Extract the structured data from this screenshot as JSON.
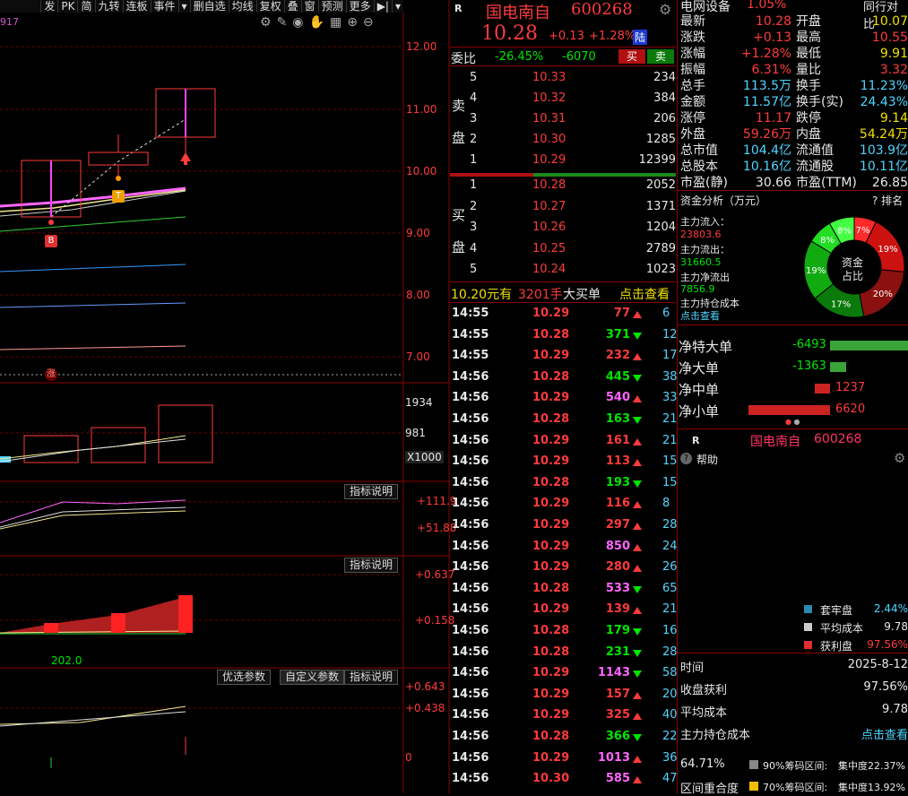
{
  "toolbar": {
    "items": [
      "发",
      "PK",
      "简",
      "九转",
      "连板",
      "事件",
      "▾",
      "删自选",
      "均线",
      "复权",
      "叠",
      "窗",
      "预测",
      "更多",
      "▶|",
      "▾"
    ]
  },
  "chart": {
    "left_code": "917",
    "price_axis": [
      "12.00",
      "11.00",
      "10.00",
      "9.00",
      "8.00",
      "7.00"
    ],
    "limit_mark": "涨",
    "marker_b": "B",
    "marker_t": "T",
    "vol_axis": [
      "1934",
      "981",
      "X1000"
    ],
    "ind1": {
      "btn": "指标说明",
      "axis": [
        "+111.9",
        "+51.88"
      ]
    },
    "ind2": {
      "btn": "指标说明",
      "axis": [
        "+0.637",
        "+0.158"
      ],
      "value": "202.0"
    },
    "ind3": {
      "btn1": "优选参数",
      "btn2": "自定义参数",
      "btn3": "指标说明",
      "axis": [
        "+0.643",
        "+0.438",
        "0"
      ]
    }
  },
  "quote": {
    "r": "R",
    "name": "国电南自",
    "code": "600268",
    "price": "10.28",
    "chg": "+0.13",
    "pct": "+1.28%",
    "lu": "陆",
    "weibi_label": "委比",
    "weibi_pct": "-26.45%",
    "weibi_val": "-6070",
    "buy": "买",
    "sell": "卖",
    "sell_label": "卖盘",
    "buy_label": "买盘",
    "asks": [
      {
        "lvl": "5",
        "p": "10.33",
        "v": "234"
      },
      {
        "lvl": "4",
        "p": "10.32",
        "v": "384"
      },
      {
        "lvl": "3",
        "p": "10.31",
        "v": "206"
      },
      {
        "lvl": "2",
        "p": "10.30",
        "v": "1285"
      },
      {
        "lvl": "1",
        "p": "10.29",
        "v": "12399"
      }
    ],
    "bids": [
      {
        "lvl": "1",
        "p": "10.28",
        "v": "2052"
      },
      {
        "lvl": "2",
        "p": "10.27",
        "v": "1371"
      },
      {
        "lvl": "3",
        "p": "10.26",
        "v": "1204"
      },
      {
        "lvl": "4",
        "p": "10.25",
        "v": "2789"
      },
      {
        "lvl": "5",
        "p": "10.24",
        "v": "1023"
      }
    ],
    "bigorder": {
      "p": "10.20元有",
      "v": "3201手",
      "t": "大买单",
      "link": "点击查看"
    }
  },
  "ticks": [
    {
      "t": "14:55",
      "p": "10.29",
      "v": "77",
      "d": "up",
      "n": "6"
    },
    {
      "t": "14:55",
      "p": "10.28",
      "v": "371",
      "d": "dn",
      "n": "12"
    },
    {
      "t": "14:55",
      "p": "10.29",
      "v": "232",
      "d": "up",
      "n": "17"
    },
    {
      "t": "14:56",
      "p": "10.28",
      "v": "445",
      "d": "dn",
      "n": "38"
    },
    {
      "t": "14:56",
      "p": "10.29",
      "v": "540",
      "d": "up",
      "n": "33"
    },
    {
      "t": "14:56",
      "p": "10.28",
      "v": "163",
      "d": "dn",
      "n": "21"
    },
    {
      "t": "14:56",
      "p": "10.29",
      "v": "161",
      "d": "up",
      "n": "21"
    },
    {
      "t": "14:56",
      "p": "10.29",
      "v": "113",
      "d": "up",
      "n": "15"
    },
    {
      "t": "14:56",
      "p": "10.28",
      "v": "193",
      "d": "dn",
      "n": "15"
    },
    {
      "t": "14:56",
      "p": "10.29",
      "v": "116",
      "d": "up",
      "n": "8"
    },
    {
      "t": "14:56",
      "p": "10.29",
      "v": "297",
      "d": "up",
      "n": "28"
    },
    {
      "t": "14:56",
      "p": "10.29",
      "v": "850",
      "d": "up",
      "n": "24"
    },
    {
      "t": "14:56",
      "p": "10.29",
      "v": "280",
      "d": "up",
      "n": "26"
    },
    {
      "t": "14:56",
      "p": "10.28",
      "v": "533",
      "d": "dn",
      "n": "65"
    },
    {
      "t": "14:56",
      "p": "10.29",
      "v": "139",
      "d": "up",
      "n": "21"
    },
    {
      "t": "14:56",
      "p": "10.28",
      "v": "179",
      "d": "dn",
      "n": "16"
    },
    {
      "t": "14:56",
      "p": "10.28",
      "v": "231",
      "d": "dn",
      "n": "28"
    },
    {
      "t": "14:56",
      "p": "10.29",
      "v": "1143",
      "d": "dn",
      "n": "58"
    },
    {
      "t": "14:56",
      "p": "10.29",
      "v": "157",
      "d": "up",
      "n": "20"
    },
    {
      "t": "14:56",
      "p": "10.29",
      "v": "325",
      "d": "up",
      "n": "40"
    },
    {
      "t": "14:56",
      "p": "10.28",
      "v": "366",
      "d": "dn",
      "n": "22"
    },
    {
      "t": "14:56",
      "p": "10.29",
      "v": "1013",
      "d": "up",
      "n": "36"
    },
    {
      "t": "14:56",
      "p": "10.30",
      "v": "585",
      "d": "up",
      "n": "47"
    }
  ],
  "stats": {
    "sector": "电网设备",
    "sector_pct": "1.05%",
    "peer": "同行对比",
    "rows": [
      [
        "最新",
        "10.28",
        "开盘",
        "10.07"
      ],
      [
        "涨跌",
        "+0.13",
        "最高",
        "10.55"
      ],
      [
        "涨幅",
        "+1.28%",
        "最低",
        "9.91"
      ],
      [
        "振幅",
        "6.31%",
        "量比",
        "3.32"
      ],
      [
        "总手",
        "113.5万",
        "换手",
        "11.23%"
      ],
      [
        "金额",
        "11.57亿",
        "换手(实)",
        "24.43%"
      ],
      [
        "涨停",
        "11.17",
        "跌停",
        "9.14"
      ],
      [
        "外盘",
        "59.26万",
        "内盘",
        "54.24万"
      ],
      [
        "总市值",
        "104.4亿",
        "流通值",
        "103.9亿"
      ],
      [
        "总股本",
        "10.16亿",
        "流通股",
        "10.11亿"
      ],
      [
        "市盈(静)",
        "30.66",
        "市盈(TTM)",
        "26.85"
      ]
    ]
  },
  "fund": {
    "title": "资金分析（万元）",
    "rank": "? 排名",
    "in_label": "主力流入：",
    "in_val": "23803.6",
    "out_label": "主力流出：",
    "out_val": "31660.5",
    "net_label": "主力净流出",
    "net_val": "7856.9",
    "cost_label": "主力持仓成本",
    "cost_link": "点击查看",
    "donut_center": [
      "资金",
      "占比"
    ],
    "slices": [
      {
        "label": "7%",
        "pct": 7,
        "color": "#ff2a2a"
      },
      {
        "label": "19%",
        "pct": 19,
        "color": "#cc1111"
      },
      {
        "label": "20%",
        "pct": 20,
        "color": "#8b1010"
      },
      {
        "label": "17%",
        "pct": 17,
        "color": "#0a7a0a"
      },
      {
        "label": "19%",
        "pct": 19,
        "color": "#11aa11"
      },
      {
        "label": "8%",
        "pct": 8,
        "color": "#22dd22"
      },
      {
        "label": "8%",
        "pct": 8,
        "color": "#44ff44"
      }
    ],
    "bars": [
      {
        "label": "净特大单",
        "val": "-6493",
        "color": "#3aa33a",
        "frac": 1.0
      },
      {
        "label": "净大单",
        "val": "-1363",
        "color": "#3aa33a",
        "frac": 0.21
      },
      {
        "label": "净中单",
        "val": "1237",
        "color": "#cc2222",
        "frac": 0.19
      },
      {
        "label": "净小单",
        "val": "6620",
        "color": "#cc2222",
        "frac": 1.0
      }
    ]
  },
  "chip": {
    "r": "R",
    "name": "国电南自",
    "code": "600268",
    "help": "帮助",
    "legend": [
      {
        "label": "套牢盘",
        "val": "2.44%",
        "color": "#2a8ab0"
      },
      {
        "label": "平均成本",
        "val": "9.78",
        "color": "#cccccc"
      },
      {
        "label": "获利盘",
        "val": "97.56%",
        "color": "#e03030"
      }
    ],
    "info": [
      [
        "时间",
        "2025-8-12"
      ],
      [
        "收盘获利",
        "97.56%"
      ],
      [
        "平均成本",
        "9.78"
      ],
      [
        "主力持仓成本",
        "点击查看"
      ]
    ],
    "pct": "64.71%",
    "row90": "90%筹码区间:",
    "row90c": "集中度22.37%",
    "row70": "70%筹码区间:",
    "row70c": "集中度13.92%",
    "overlap": "区间重合度"
  }
}
